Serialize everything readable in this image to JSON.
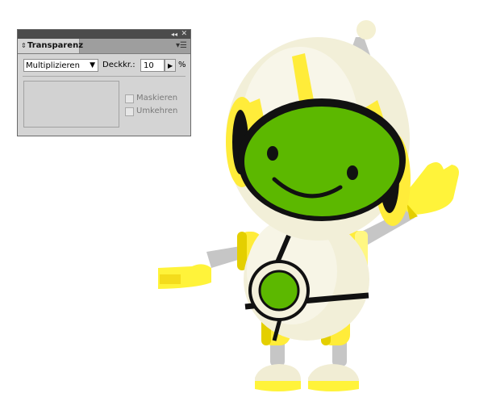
{
  "panel": {
    "tab_label": "Transparenz",
    "blend_mode": "Multiplizieren",
    "opacity_label": "Deckkr.:",
    "opacity_value": "10",
    "percent": "%",
    "mask_label": "Maskieren",
    "invert_label": "Umkehren",
    "collapse_icon": "collapse-arrows-icon",
    "close_icon": "close-icon",
    "menu_icon": "panel-menu-icon"
  },
  "colors": {
    "panel_bg": "#d4d4d4",
    "titlebar": "#4b4b4b",
    "robot_green": "#5cb800",
    "robot_yellow": "#ffec3a",
    "robot_cream": "#f3f0dc"
  }
}
